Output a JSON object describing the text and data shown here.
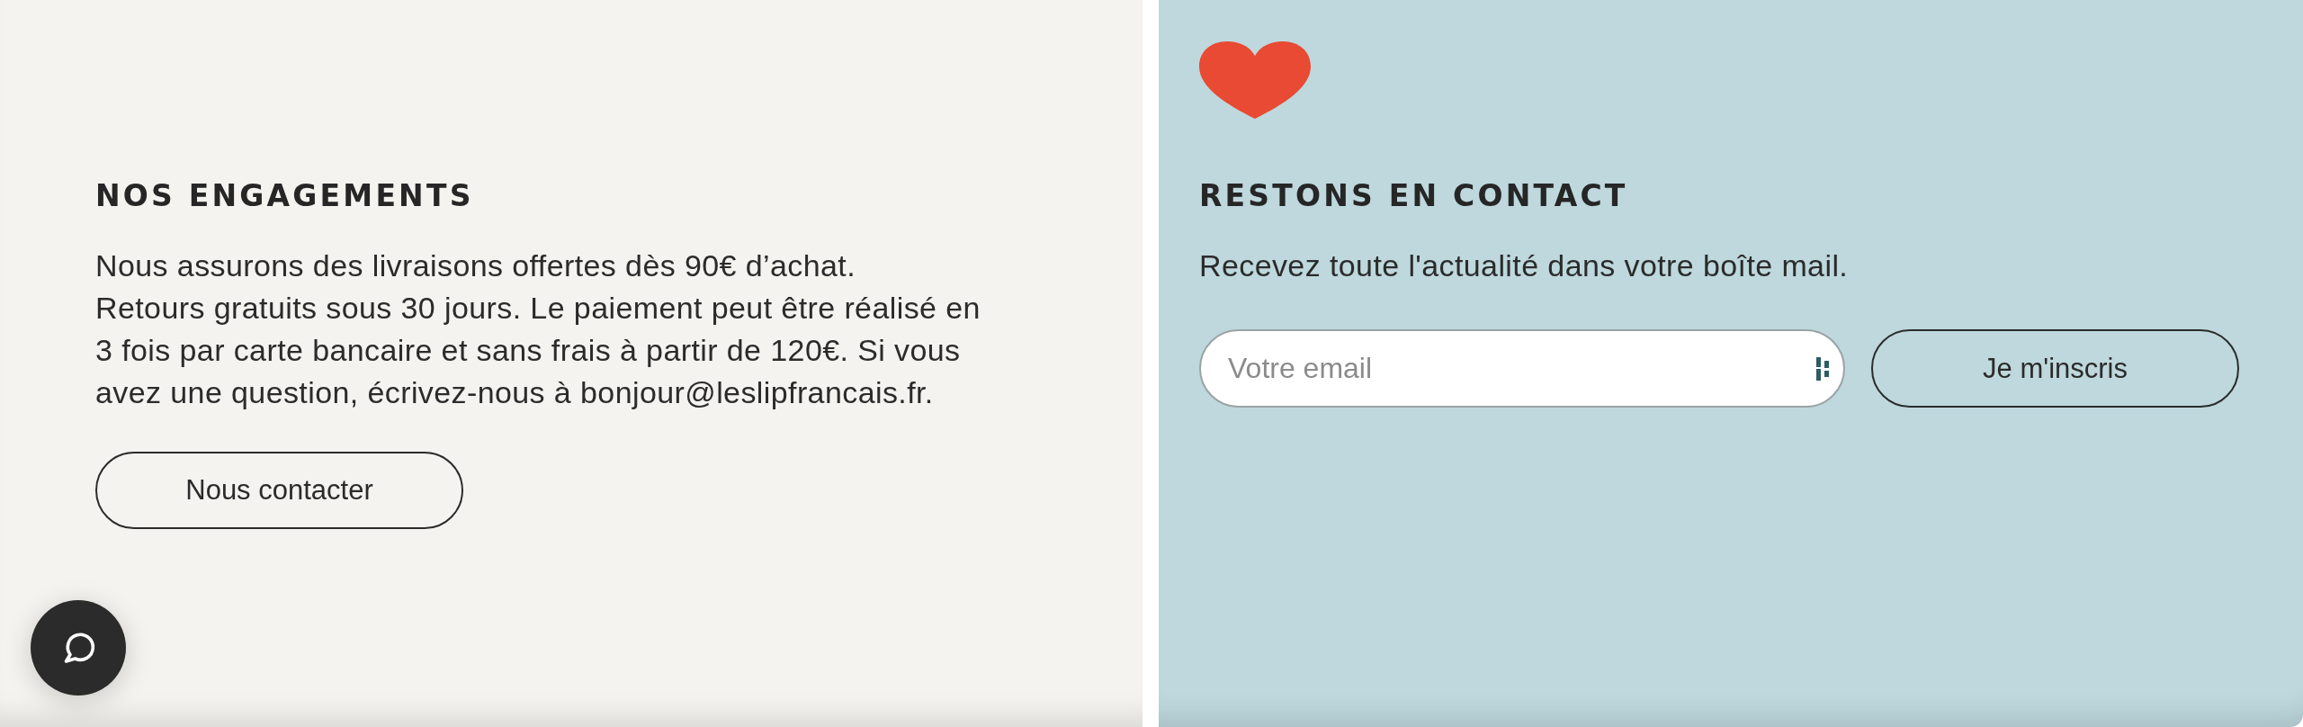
{
  "engagements": {
    "title": "NOS ENGAGEMENTS",
    "text": "Nous assurons des livraisons offertes dès 90€ d’achat.\nRetours gratuits sous 30 jours. Le paiement peut être réalisé en 3 fois par carte bancaire et sans frais à partir de 120€. Si vous avez une question, écrivez-nous à bonjour@leslipfrancais.fr.",
    "button": "Nous contacter"
  },
  "contact": {
    "title": "RESTONS EN CONTACT",
    "text": "Recevez toute l'actualité dans votre boîte mail.",
    "email_field": {
      "placeholder": "Votre email"
    },
    "button": "Je m'inscris"
  }
}
